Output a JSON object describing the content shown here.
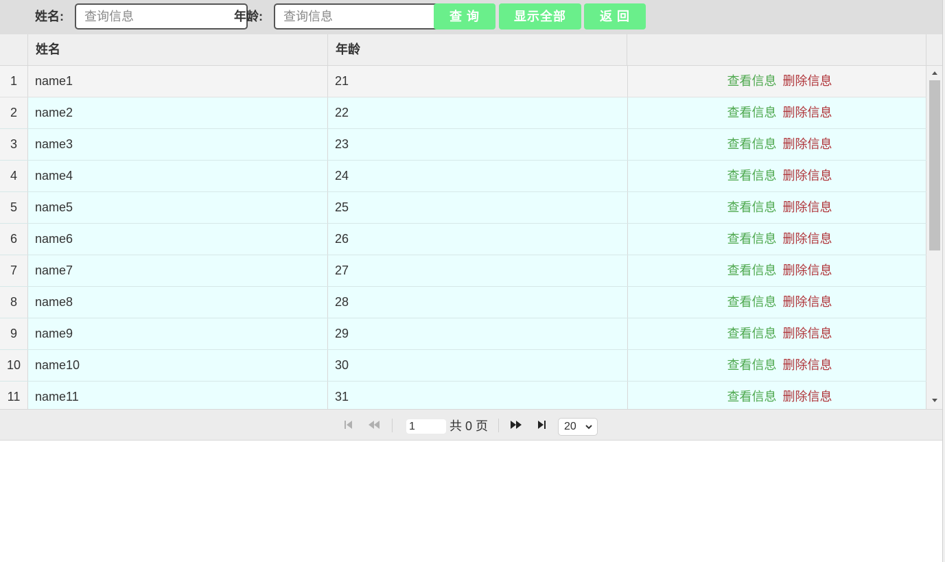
{
  "toolbar": {
    "name_label": "姓名:",
    "name_placeholder": "查询信息",
    "name_value": "",
    "age_label": "年龄:",
    "age_placeholder": "查询信息",
    "age_value": "",
    "query_button": "查 询",
    "show_all_button": "显示全部",
    "back_button": "返 回"
  },
  "grid": {
    "columns": [
      "姓名",
      "年龄",
      ""
    ],
    "rows": [
      {
        "num": "1",
        "name": "name1",
        "age": "21"
      },
      {
        "num": "2",
        "name": "name2",
        "age": "22"
      },
      {
        "num": "3",
        "name": "name3",
        "age": "23"
      },
      {
        "num": "4",
        "name": "name4",
        "age": "24"
      },
      {
        "num": "5",
        "name": "name5",
        "age": "25"
      },
      {
        "num": "6",
        "name": "name6",
        "age": "26"
      },
      {
        "num": "7",
        "name": "name7",
        "age": "27"
      },
      {
        "num": "8",
        "name": "name8",
        "age": "28"
      },
      {
        "num": "9",
        "name": "name9",
        "age": "29"
      },
      {
        "num": "10",
        "name": "name10",
        "age": "30"
      },
      {
        "num": "11",
        "name": "name11",
        "age": "31"
      }
    ],
    "view_label": "查看信息",
    "delete_label": "删除信息",
    "selected_row": 0
  },
  "pager": {
    "page_value": "1",
    "total_text": "共 0 页",
    "page_size": "20",
    "icons": [
      "first-page-icon",
      "prev-page-icon",
      "next-page-icon",
      "last-page-icon"
    ]
  },
  "colors": {
    "button_bg": "#6aef8b",
    "view_link": "#4ea84e",
    "delete_link": "#b0363b",
    "row_bg": "#eaffff",
    "header_bg": "#efefef"
  }
}
